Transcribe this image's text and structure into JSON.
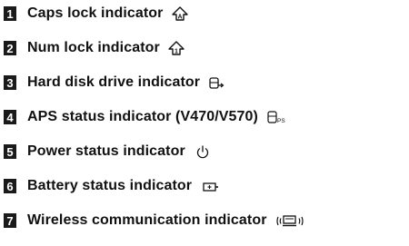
{
  "items": [
    {
      "number": "1",
      "label": "Caps lock indicator",
      "icon": "caps-lock-icon"
    },
    {
      "number": "2",
      "label": "Num lock indicator",
      "icon": "num-lock-icon"
    },
    {
      "number": "3",
      "label": "Hard disk drive indicator",
      "icon": "hard-disk-drive-icon"
    },
    {
      "number": "4",
      "label": "APS status indicator (V470/V570)",
      "icon": "aps-status-icon"
    },
    {
      "number": "5",
      "label": "Power status indicator",
      "icon": "power-icon"
    },
    {
      "number": "6",
      "label": "Battery status indicator",
      "icon": "battery-icon"
    },
    {
      "number": "7",
      "label": "Wireless communication indicator",
      "icon": "wireless-icon"
    }
  ]
}
